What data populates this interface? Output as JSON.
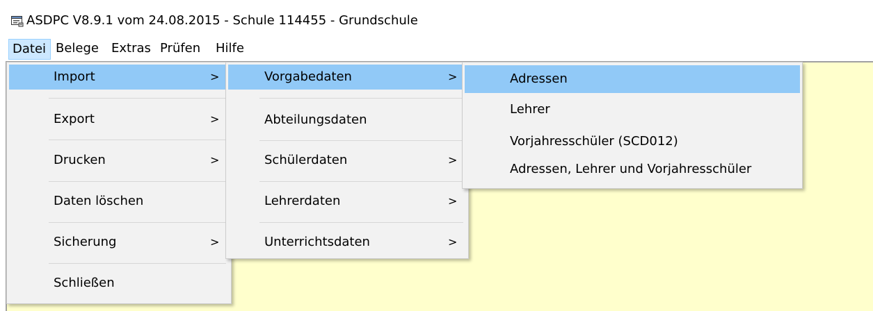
{
  "window": {
    "title": "ASDPC V8.9.1 vom 24.08.2015 - Schule 114455 - Grundschule",
    "icon": "app-window-icon"
  },
  "menubar": {
    "items": [
      "Datei",
      "Belege",
      "Extras",
      "Prüfen",
      "Hilfe"
    ],
    "active": "Datei"
  },
  "menus": {
    "datei": {
      "items": [
        {
          "label": "Import",
          "submenu_arrow": ">"
        },
        {
          "label": "Export",
          "submenu_arrow": ">"
        },
        {
          "label": "Drucken",
          "submenu_arrow": ">"
        },
        {
          "label": "Daten löschen"
        },
        {
          "label": "Sicherung",
          "submenu_arrow": ">"
        },
        {
          "label": "Schließen"
        }
      ],
      "highlighted": "Import"
    },
    "import": {
      "items": [
        {
          "label": "Vorgabedaten",
          "submenu_arrow": ">"
        },
        {
          "label": "Abteilungsdaten"
        },
        {
          "label": "Schülerdaten",
          "submenu_arrow": ">"
        },
        {
          "label": "Lehrerdaten",
          "submenu_arrow": ">"
        },
        {
          "label": "Unterrichtsdaten",
          "submenu_arrow": ">"
        }
      ],
      "highlighted": "Vorgabedaten"
    },
    "vorgabedaten": {
      "items": [
        {
          "label": "Adressen"
        },
        {
          "label": "Lehrer"
        },
        {
          "label": "Vorjahresschüler (SCD012)"
        },
        {
          "label": "Adressen, Lehrer und Vorjahresschüler"
        }
      ],
      "highlighted": "Adressen"
    }
  },
  "colors": {
    "client_background": "#ffffcc",
    "menu_background": "#f2f2f2",
    "highlight": "#91c9f7",
    "menubar_active": "#cce8ff"
  }
}
